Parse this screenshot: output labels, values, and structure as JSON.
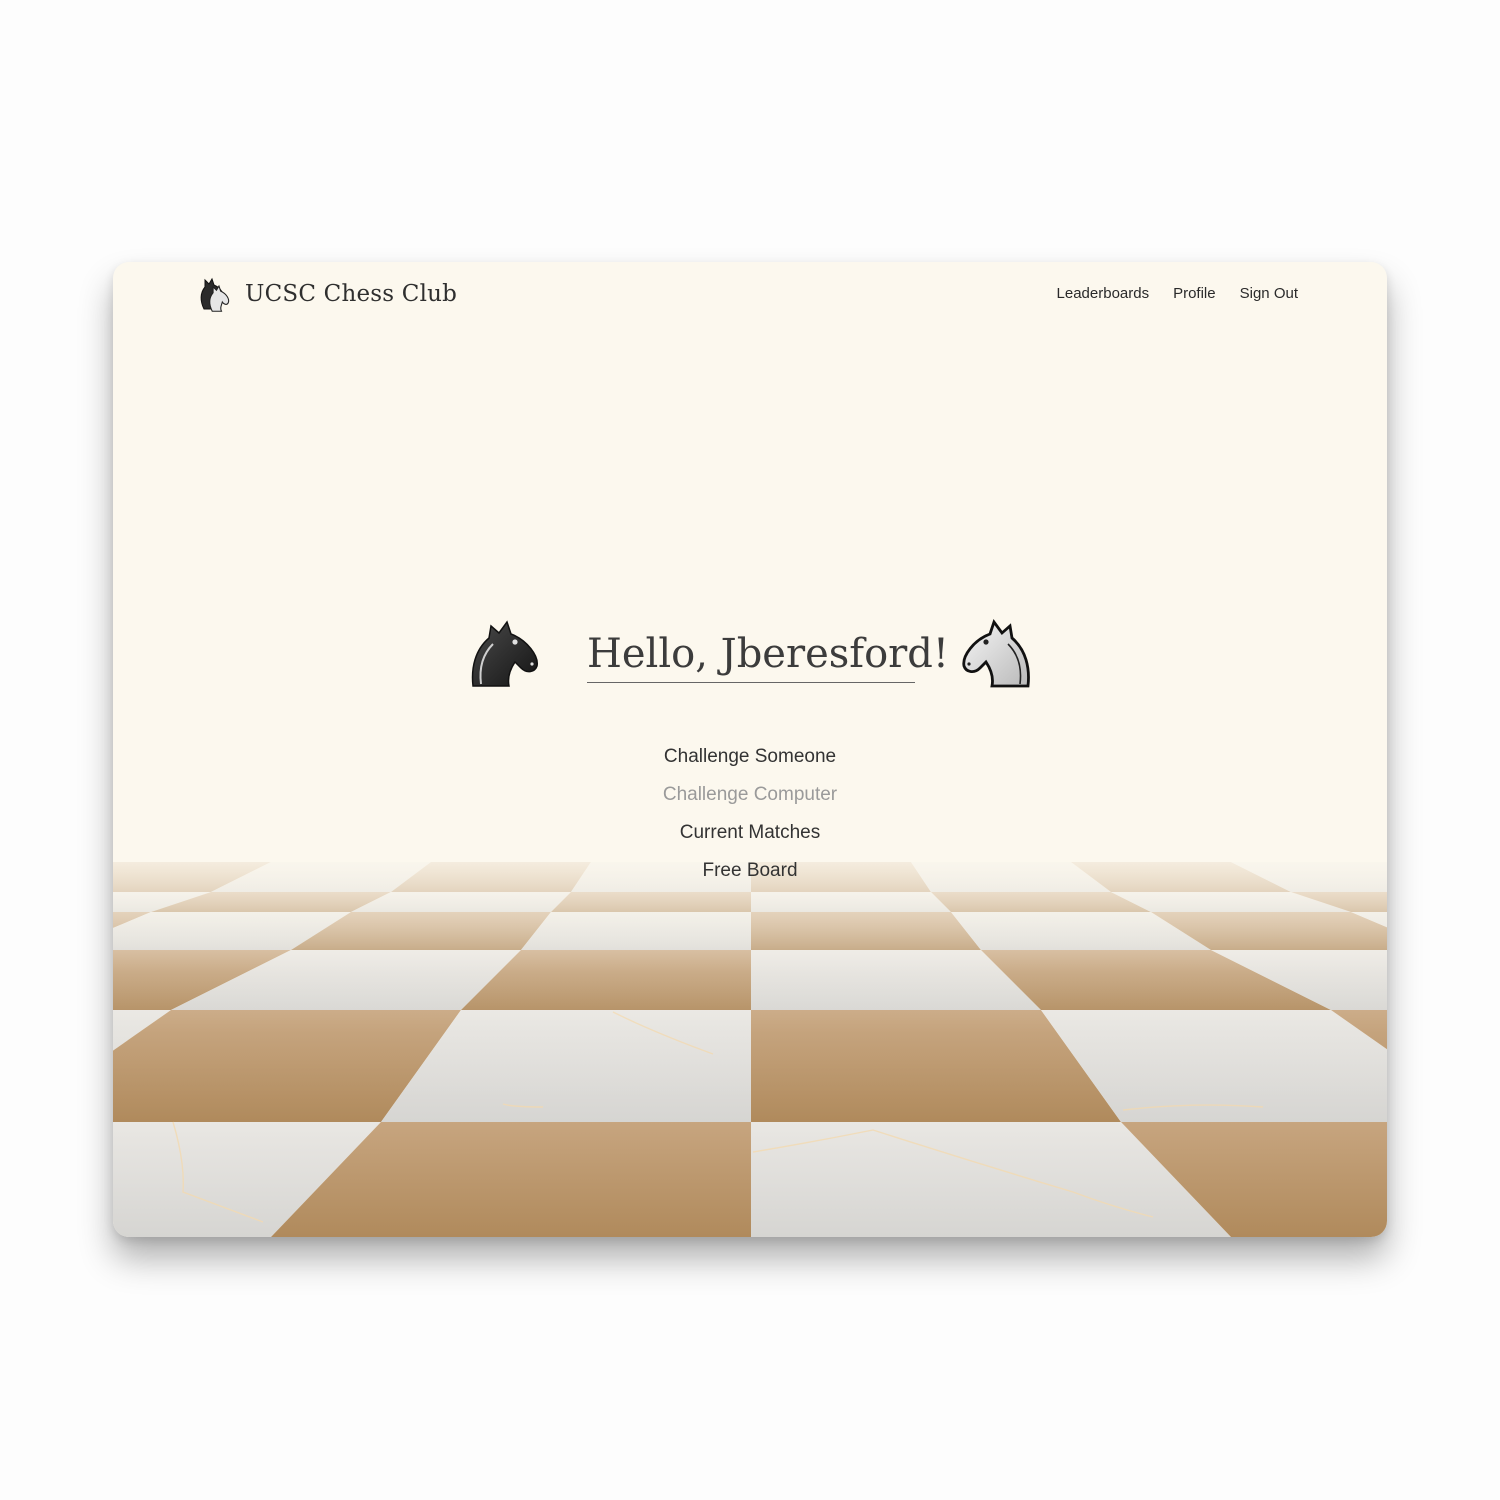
{
  "app": {
    "title": "UCSC Chess Club",
    "logo_icon": "knight-pair-icon"
  },
  "nav": {
    "items": [
      {
        "label": "Leaderboards",
        "name": "nav-leaderboards"
      },
      {
        "label": "Profile",
        "name": "nav-profile"
      },
      {
        "label": "Sign Out",
        "name": "nav-sign-out"
      }
    ]
  },
  "hero": {
    "greeting": "Hello, Jberesford!",
    "left_icon": "black-knight-icon",
    "right_icon": "white-knight-icon"
  },
  "menu": {
    "items": [
      {
        "label": "Challenge Someone",
        "state": "normal"
      },
      {
        "label": "Challenge Computer",
        "state": "dimmed"
      },
      {
        "label": "Current Matches",
        "state": "normal"
      },
      {
        "label": "Free Board",
        "state": "normal"
      }
    ]
  },
  "colors": {
    "background": "#fcf8ee",
    "dark_square": "#b58f64",
    "light_square": "#dcdcdc",
    "text": "#333333",
    "dimmed_text": "#9a9a9a"
  }
}
